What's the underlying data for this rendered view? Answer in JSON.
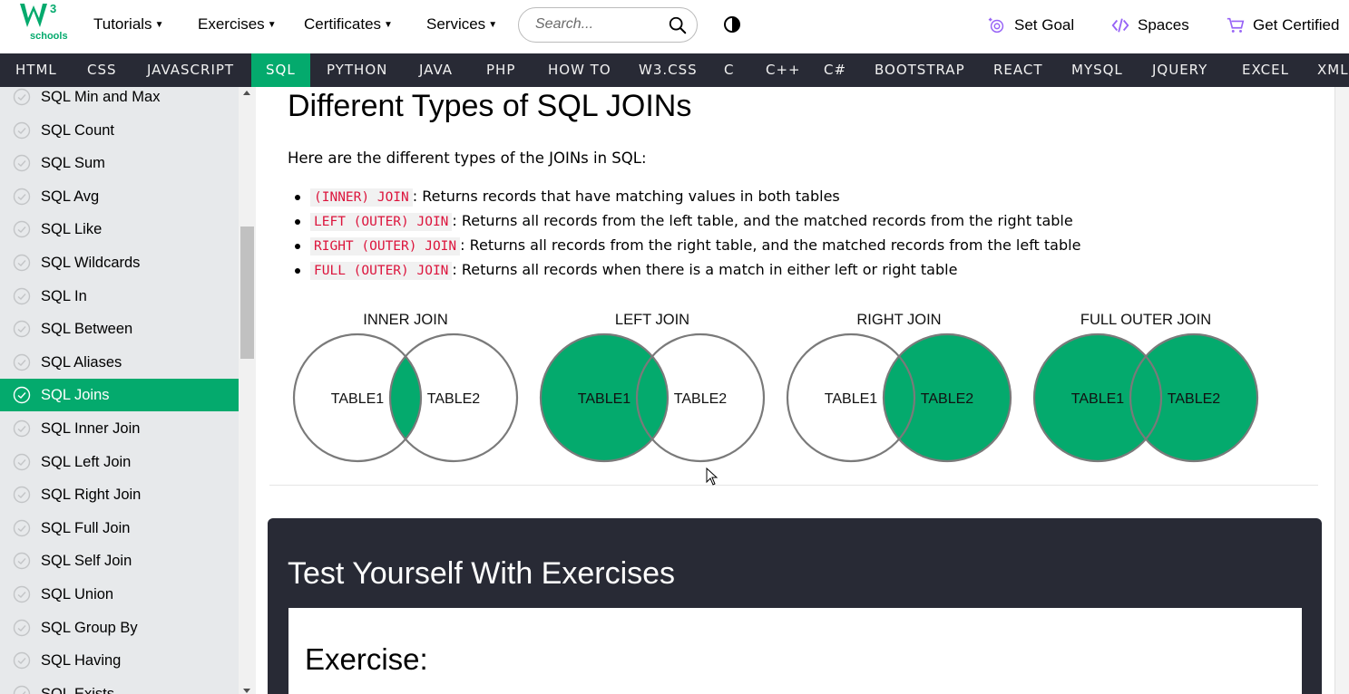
{
  "brand": {
    "logo_text": "schools",
    "accent": "#04aa6d"
  },
  "topnav": {
    "menus": [
      "Tutorials",
      "Exercises",
      "Certificates",
      "Services"
    ],
    "search_placeholder": "Search...",
    "set_goal": "Set Goal",
    "spaces": "Spaces",
    "get_certified": "Get Certified"
  },
  "subjects": [
    "HTML",
    "CSS",
    "JAVASCRIPT",
    "SQL",
    "PYTHON",
    "JAVA",
    "PHP",
    "HOW TO",
    "W3.CSS",
    "C",
    "C++",
    "C#",
    "BOOTSTRAP",
    "REACT",
    "MYSQL",
    "JQUERY",
    "EXCEL",
    "XML"
  ],
  "active_subject": "SQL",
  "sidebar": {
    "items": [
      "SQL Min and Max",
      "SQL Count",
      "SQL Sum",
      "SQL Avg",
      "SQL Like",
      "SQL Wildcards",
      "SQL In",
      "SQL Between",
      "SQL Aliases",
      "SQL Joins",
      "SQL Inner Join",
      "SQL Left Join",
      "SQL Right Join",
      "SQL Full Join",
      "SQL Self Join",
      "SQL Union",
      "SQL Group By",
      "SQL Having",
      "SQL Exists"
    ],
    "active": "SQL Joins"
  },
  "content": {
    "heading": "Different Types of SQL JOINs",
    "intro": "Here are the different types of the JOINs in SQL:",
    "bullets": [
      {
        "code": "(INNER) JOIN",
        "text": ": Returns records that have matching values in both tables"
      },
      {
        "code": "LEFT (OUTER) JOIN",
        "text": ": Returns all records from the left table, and the matched records from the right table"
      },
      {
        "code": "RIGHT (OUTER) JOIN",
        "text": ": Returns all records from the right table, and the matched records from the left table"
      },
      {
        "code": "FULL (OUTER) JOIN",
        "text": ": Returns all records when there is a match in either left or right table"
      }
    ],
    "diagrams": [
      {
        "title": "INNER JOIN",
        "left": "TABLE1",
        "right": "TABLE2",
        "fill": "inner"
      },
      {
        "title": "LEFT JOIN",
        "left": "TABLE1",
        "right": "TABLE2",
        "fill": "left"
      },
      {
        "title": "RIGHT JOIN",
        "left": "TABLE1",
        "right": "TABLE2",
        "fill": "right"
      },
      {
        "title": "FULL OUTER JOIN",
        "left": "TABLE1",
        "right": "TABLE2",
        "fill": "full"
      }
    ],
    "exercise_heading": "Test Yourself With Exercises",
    "exercise_label": "Exercise:"
  }
}
